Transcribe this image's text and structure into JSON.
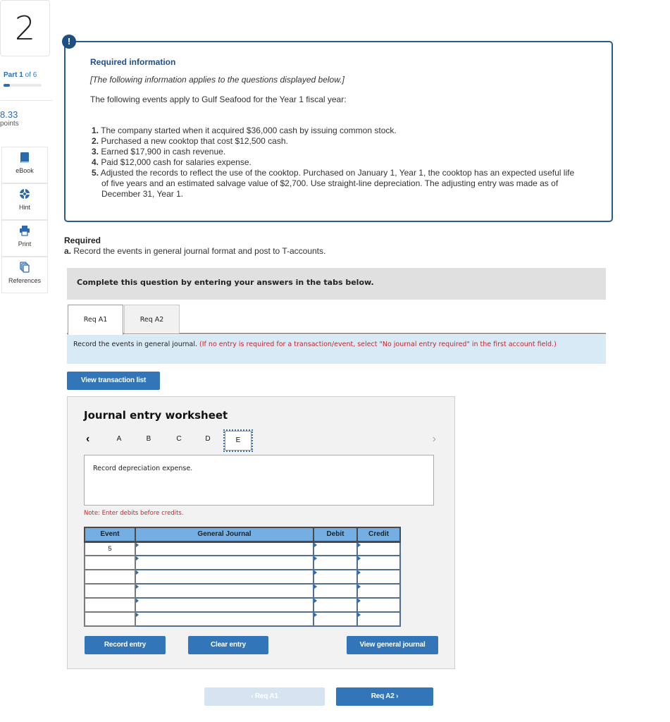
{
  "sidebar": {
    "question_number": "2",
    "part": {
      "label": "Part",
      "current": "1",
      "of_label": "of",
      "total": "6",
      "progress_fraction": 0.1667
    },
    "points_value": "8.33",
    "points_label": "points",
    "tools": [
      {
        "label": "eBook",
        "icon": "book-icon"
      },
      {
        "label": "Hint",
        "icon": "lifebuoy-icon"
      },
      {
        "label": "Print",
        "icon": "printer-icon"
      },
      {
        "label": "References",
        "icon": "copy-documents-icon"
      }
    ]
  },
  "info": {
    "badge": "!",
    "title": "Required information",
    "note": "[The following information applies to the questions displayed below.]",
    "intro": "The following events apply to Gulf Seafood for the Year 1 fiscal year:",
    "events": [
      {
        "num": "1.",
        "text": "The company started when it acquired $36,000 cash by issuing common stock."
      },
      {
        "num": "2.",
        "text": "Purchased a new cooktop that cost $12,500 cash."
      },
      {
        "num": "3.",
        "text": "Earned $17,900 in cash revenue."
      },
      {
        "num": "4.",
        "text": "Paid $12,000 cash for salaries expense."
      },
      {
        "num": "5.",
        "text": "Adjusted the records to reflect the use of the cooktop. Purchased on January 1, Year 1, the cooktop has an expected useful life of five years and an estimated salvage value of $2,700. Use straight-line depreciation. The adjusting entry was made as of December 31, Year 1."
      }
    ]
  },
  "required": {
    "title": "Required",
    "a_label": "a.",
    "a_text": "Record the events in general journal format and post to T-accounts."
  },
  "complete_banner": "Complete this question by entering your answers in the tabs below.",
  "tabs": [
    {
      "label": "Req A1",
      "active": true
    },
    {
      "label": "Req A2",
      "active": false
    }
  ],
  "instruction": {
    "main": "Record the events in general journal.",
    "note": "(If no entry is required for a transaction/event, select \"No journal entry required\" in the first account field.)"
  },
  "view_transaction_list_label": "View transaction list",
  "worksheet": {
    "title": "Journal entry worksheet",
    "prev_icon": "‹",
    "next_icon": "›",
    "letters": [
      "A",
      "B",
      "C",
      "D",
      "E"
    ],
    "selected_letter": "E",
    "description": "Record depreciation expense.",
    "note": "Note: Enter debits before credits.",
    "table": {
      "headers": [
        "Event",
        "General Journal",
        "Debit",
        "Credit"
      ],
      "rows": [
        {
          "event": "5",
          "account": "",
          "debit": "",
          "credit": ""
        },
        {
          "event": "",
          "account": "",
          "debit": "",
          "credit": ""
        },
        {
          "event": "",
          "account": "",
          "debit": "",
          "credit": ""
        },
        {
          "event": "",
          "account": "",
          "debit": "",
          "credit": ""
        },
        {
          "event": "",
          "account": "",
          "debit": "",
          "credit": ""
        },
        {
          "event": "",
          "account": "",
          "debit": "",
          "credit": ""
        }
      ]
    },
    "record_entry_label": "Record entry",
    "clear_entry_label": "Clear entry",
    "view_general_journal_label": "View general journal"
  },
  "bottom_nav": {
    "prev_label": "‹  Req A1",
    "next_label": "Req A2  ›"
  }
}
